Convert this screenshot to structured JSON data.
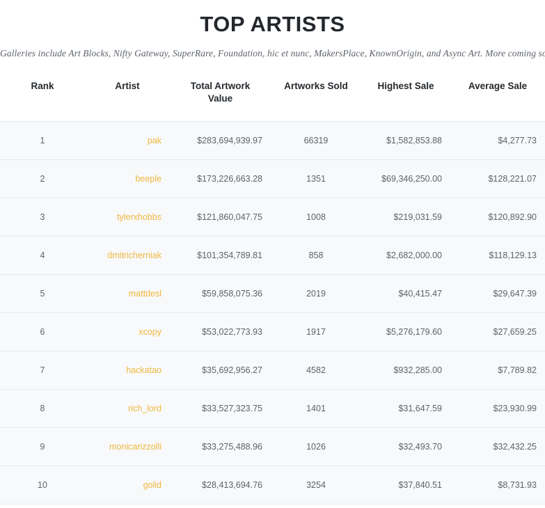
{
  "header": {
    "title": "TOP ARTISTS",
    "subtitle": "Galleries include Art Blocks, Nifty Gateway, SuperRare, Foundation, hic et nunc, MakersPlace, KnownOrigin, and Async Art. More coming soon."
  },
  "colors": {
    "page_background": "#ffffff",
    "row_background": "#f8f9fa",
    "row_border": "#e6e8eb",
    "title_text": "#24282c",
    "subtitle_text": "#5d636b",
    "body_text": "#5c636b",
    "artist_link": "#efb73e"
  },
  "table": {
    "columns": [
      {
        "key": "rank",
        "label": "Rank",
        "align": "center"
      },
      {
        "key": "artist",
        "label": "Artist",
        "align": "right"
      },
      {
        "key": "total",
        "label": "Total Artwork Value",
        "align": "right"
      },
      {
        "key": "sold",
        "label": "Artworks Sold",
        "align": "center"
      },
      {
        "key": "highest",
        "label": "Highest Sale",
        "align": "right"
      },
      {
        "key": "average",
        "label": "Average Sale",
        "align": "right"
      }
    ],
    "rows": [
      {
        "rank": "1",
        "artist": "pak",
        "total": "$283,694,939.97",
        "sold": "66319",
        "highest": "$1,582,853.88",
        "average": "$4,277.73"
      },
      {
        "rank": "2",
        "artist": "beeple",
        "total": "$173,226,663.28",
        "sold": "1351",
        "highest": "$69,346,250.00",
        "average": "$128,221.07"
      },
      {
        "rank": "3",
        "artist": "tylerxhobbs",
        "total": "$121,860,047.75",
        "sold": "1008",
        "highest": "$219,031.59",
        "average": "$120,892.90"
      },
      {
        "rank": "4",
        "artist": "dmitricherniak",
        "total": "$101,354,789.81",
        "sold": "858",
        "highest": "$2,682,000.00",
        "average": "$118,129.13"
      },
      {
        "rank": "5",
        "artist": "mattdesl",
        "total": "$59,858,075.36",
        "sold": "2019",
        "highest": "$40,415.47",
        "average": "$29,647.39"
      },
      {
        "rank": "6",
        "artist": "xcopy",
        "total": "$53,022,773.93",
        "sold": "1917",
        "highest": "$5,276,179.60",
        "average": "$27,659.25"
      },
      {
        "rank": "7",
        "artist": "hackatao",
        "total": "$35,692,956.27",
        "sold": "4582",
        "highest": "$932,285.00",
        "average": "$7,789.82"
      },
      {
        "rank": "8",
        "artist": "rich_lord",
        "total": "$33,527,323.75",
        "sold": "1401",
        "highest": "$31,647.59",
        "average": "$23,930.99"
      },
      {
        "rank": "9",
        "artist": "monicarizzolli",
        "total": "$33,275,488.96",
        "sold": "1026",
        "highest": "$32,493.70",
        "average": "$32,432.25"
      },
      {
        "rank": "10",
        "artist": "golid",
        "total": "$28,413,694.76",
        "sold": "3254",
        "highest": "$37,840.51",
        "average": "$8,731.93"
      }
    ]
  }
}
